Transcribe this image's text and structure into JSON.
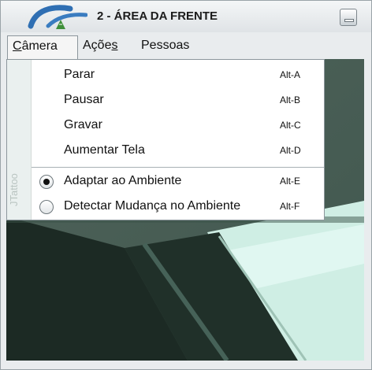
{
  "window": {
    "title": "2 - ÁREA DA FRENTE"
  },
  "menubar": {
    "camera_label": "Câmera",
    "acoes_prefix": "Açõe",
    "acoes_mnemonic": "s",
    "pessoas_label": "Pessoas"
  },
  "camera_menu": {
    "side_label": "JTattoo",
    "items": [
      {
        "label": "Parar",
        "accelerator": "Alt-A"
      },
      {
        "label": "Pausar",
        "accelerator": "Alt-B"
      },
      {
        "label": "Gravar",
        "accelerator": "Alt-C"
      },
      {
        "label": "Aumentar Tela",
        "accelerator": "Alt-D"
      }
    ],
    "radio_items": [
      {
        "label": "Adaptar ao Ambiente",
        "accelerator": "Alt-E",
        "selected": true
      },
      {
        "label": "Detectar Mudança no Ambiente",
        "accelerator": "Alt-F",
        "selected": false
      }
    ]
  },
  "colors": {
    "accent_blue": "#2f6fb3",
    "menu_border": "#8c969c"
  },
  "icons": {
    "logo": "app-logo-icon",
    "minimize": "minimize-icon"
  }
}
